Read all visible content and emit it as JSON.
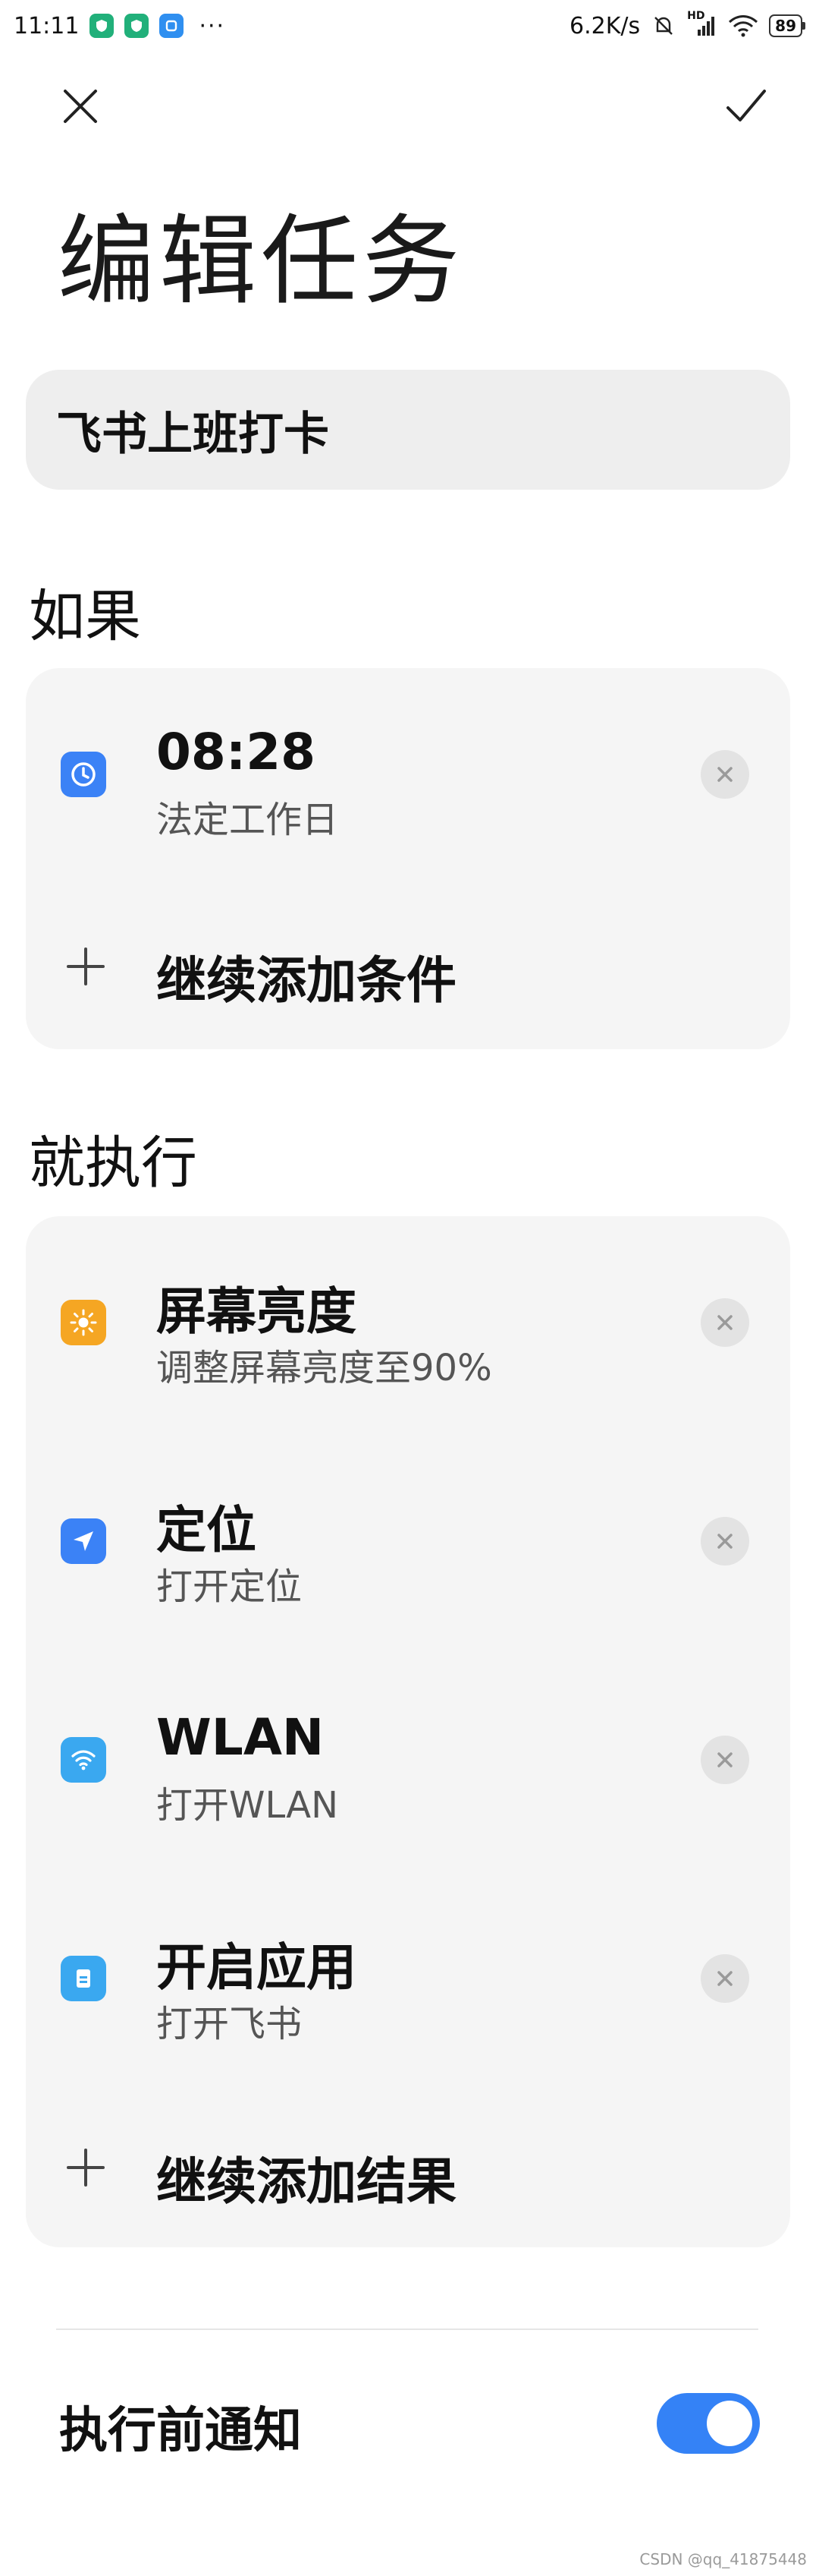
{
  "status_bar": {
    "time": "11:11",
    "speed": "6.2K/s",
    "network": "HD",
    "battery": "89",
    "more": "···"
  },
  "page": {
    "title": "编辑任务",
    "task_name": "飞书上班打卡"
  },
  "if_section": {
    "label": "如果",
    "conditions": [
      {
        "title": "08:28",
        "subtitle": "法定工作日",
        "icon": "clock-icon",
        "icon_color": "#3b82f6"
      }
    ],
    "add_label": "继续添加条件"
  },
  "then_section": {
    "label": "就执行",
    "actions": [
      {
        "title": "屏幕亮度",
        "subtitle": "调整屏幕亮度至90%",
        "icon": "sun-icon",
        "icon_color": "#f5a623"
      },
      {
        "title": "定位",
        "subtitle": "打开定位",
        "icon": "location-arrow-icon",
        "icon_color": "#3b82f6"
      },
      {
        "title": "WLAN",
        "subtitle": "打开WLAN",
        "icon": "wifi-icon",
        "icon_color": "#3aa8f0"
      },
      {
        "title": "开启应用",
        "subtitle": "打开飞书",
        "icon": "app-icon",
        "icon_color": "#3aa8f0"
      }
    ],
    "add_label": "继续添加结果"
  },
  "notify": {
    "label": "执行前通知",
    "enabled": true,
    "toggle_color": "#3482f6"
  },
  "watermark": "CSDN @qq_41875448"
}
